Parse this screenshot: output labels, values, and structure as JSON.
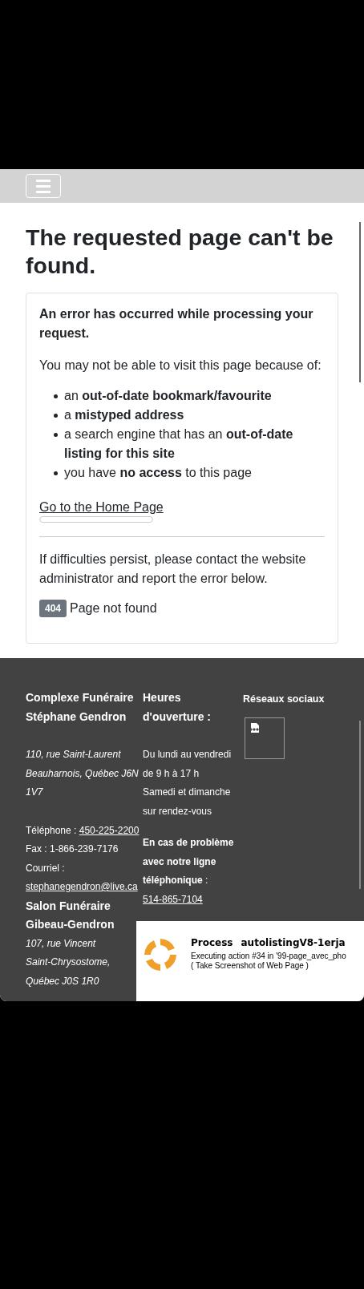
{
  "heading": "The requested page can't be found.",
  "card": {
    "intro": "An error has occurred while processing your request.",
    "lead": "You may not be able to visit this page because of:",
    "reasons": [
      "an **out-of-date bookmark/favourite**",
      "a **mistyped address**",
      "a search engine that has an **out-of-date listing for this site**",
      "you have **no access** to this page"
    ],
    "home_link": "Go to the Home Page",
    "contact": "If difficulties persist, please contact the website administrator and report the error below.",
    "error": {
      "code": "404",
      "message": "Page not found"
    }
  },
  "footer": {
    "company": {
      "name": "Complexe Funéraire Stéphane Gendron",
      "address": [
        "110, rue Saint-Laurent",
        "Beauharnois, Québec J6N 1V7"
      ],
      "phone_label": "Téléphone : ",
      "phone": "450-225-2200",
      "fax": "Fax : 1-866-239-7176",
      "email_label": "Courriel : ",
      "email": "stephanegendron@live.ca"
    },
    "hours": {
      "title": "Heures d'ouverture :",
      "lines": [
        "Du lundi au vendredi",
        "de 9 h à 17 h",
        "Samedi et dimanche",
        "sur rendez-vous"
      ],
      "problem": "En cas de problème avec notre ligne téléphonique",
      "problem_suffix": " :",
      "problem_phone": "514-865-7104"
    },
    "social": {
      "title": "Réseaux sociaux"
    },
    "salon": {
      "name": "Salon Funéraire Gibeau-Gendron",
      "address": [
        "107, rue Vincent",
        "Saint-Chrysostome,",
        "Québec J0S 1R0"
      ]
    }
  },
  "popup": {
    "title": "Process",
    "process": "autolistingV8-1erja",
    "action": "Executing action #34 in '99-page_avec_pho",
    "detail": "( Take Screenshot of Web Page )"
  }
}
